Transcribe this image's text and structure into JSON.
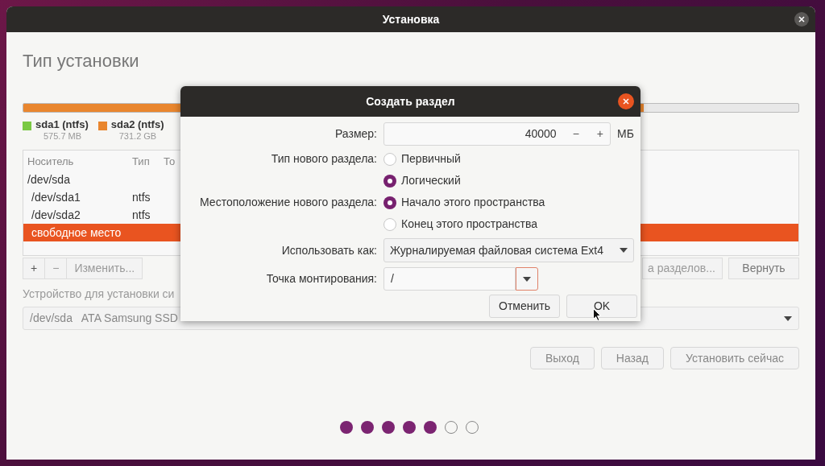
{
  "window": {
    "title": "Установка"
  },
  "page_title": "Тип установки",
  "disk_bar": {
    "level": 0.8
  },
  "legend": [
    {
      "name": "sda1 (ntfs)",
      "size": "575.7 MB",
      "color": "#7ac943"
    },
    {
      "name": "sda2 (ntfs)",
      "size": "731.2 GB",
      "color": "#e9862e"
    }
  ],
  "table": {
    "columns": [
      "Носитель",
      "Тип",
      "То"
    ],
    "rows": [
      {
        "device": "/dev/sda",
        "selected": false,
        "children": [
          {
            "device": "/dev/sda1",
            "type": "ntfs",
            "selected": false
          },
          {
            "device": "/dev/sda2",
            "type": "ntfs",
            "selected": false
          },
          {
            "device": "свободное место",
            "selected": true
          }
        ]
      }
    ]
  },
  "table_buttons": [
    {
      "label": "+",
      "disabled": false
    },
    {
      "label": "−",
      "disabled": true
    },
    {
      "label": "Изменить...",
      "disabled": true
    }
  ],
  "table_buttons_right": [
    {
      "label": "а разделов...",
      "disabled": true
    },
    {
      "label": "Вернуть",
      "disabled": false
    }
  ],
  "boot_device": {
    "label": "Устройство для установки си",
    "value": "/dev/sda   ATA Samsung SSD"
  },
  "buttons": [
    {
      "label": "Выход"
    },
    {
      "label": "Назад"
    },
    {
      "label": "Установить сейчас"
    }
  ],
  "progress_dots": [
    {
      "done": true
    },
    {
      "done": true
    },
    {
      "done": true
    },
    {
      "done": true
    },
    {
      "done": true
    },
    {
      "done": false
    },
    {
      "done": false
    }
  ],
  "dialog": {
    "title": "Создать раздел",
    "size": {
      "label": "Размер:",
      "value": "40000",
      "minus": "−",
      "plus": "+",
      "unit": "МБ"
    },
    "type": {
      "label": "Тип нового раздела:",
      "options": [
        {
          "label": "Первичный",
          "selected": false
        },
        {
          "label": "Логический",
          "selected": true
        }
      ]
    },
    "location": {
      "label": "Местоположение нового раздела:",
      "options": [
        {
          "label": "Начало этого пространства",
          "selected": true
        },
        {
          "label": "Конец этого пространства",
          "selected": false
        }
      ]
    },
    "use_as": {
      "label": "Использовать как:",
      "value": "Журналируемая файловая система Ext4"
    },
    "mount": {
      "label": "Точка монтирования:",
      "value": "/",
      "focused": true
    },
    "buttons": [
      {
        "label": "Отменить"
      },
      {
        "label": "OK"
      }
    ]
  }
}
